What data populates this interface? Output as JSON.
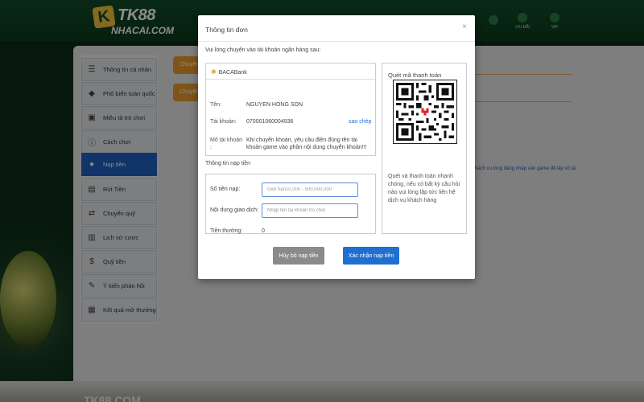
{
  "site": {
    "logo_mark": "K",
    "logo_brand": "TK88",
    "logo_site": "NHACAI.COM",
    "nav_labels": [
      "",
      "",
      "",
      "",
      "",
      "",
      "",
      "",
      "",
      "",
      "",
      "",
      "ƯU ĐÃI",
      "VIP"
    ],
    "footer_logo": "TK88.COM"
  },
  "sidebar": {
    "items": [
      {
        "label": "Thông tin cá nhân",
        "icon": "user-card-icon",
        "active": false
      },
      {
        "label": "Phổ biến toàn quốc",
        "icon": "diamond-icon",
        "active": false
      },
      {
        "label": "Miêu tả trò chơi",
        "icon": "gamepad-icon",
        "active": false
      },
      {
        "label": "Cách chơi",
        "icon": "info-icon",
        "active": false
      },
      {
        "label": "Nạp tiền",
        "icon": "piggy-bank-icon",
        "active": true
      },
      {
        "label": "Rút Tiền",
        "icon": "withdraw-icon",
        "active": false
      },
      {
        "label": "Chuyển quỹ",
        "icon": "transfer-icon",
        "active": false
      },
      {
        "label": "Lịch sử cược",
        "icon": "history-icon",
        "active": false
      },
      {
        "label": "Quỹ tiền",
        "icon": "fund-icon",
        "active": false
      },
      {
        "label": "Ý kiến phản hồi",
        "icon": "feedback-icon",
        "active": false
      },
      {
        "label": "Kết quả mở thưởng",
        "icon": "results-icon",
        "active": false
      }
    ]
  },
  "main": {
    "tabs": [
      "Chuyển",
      "Chuyển"
    ],
    "note": "hách vụ lòng đăng nhập vào game để lấy số tài"
  },
  "modal": {
    "title": "Thông tin đơn",
    "close": "×",
    "instruction": "Vui lòng chuyển vào tài khoản ngân hàng sau:",
    "bank": {
      "name": "BACABank",
      "name_label": "Tên:",
      "name_value": "NGUYEN HONG SON",
      "account_label": "Tài khoản:",
      "account_value": "070001060004936",
      "copy_label": "sao chép",
      "memo_label": "Mô tài khoản :",
      "memo_value": "Khi chuyển khoản, yêu cầu điền đúng tên tài khoản game vào phần nội dung chuyển khoản!!!"
    },
    "deposit": {
      "section_title": "Thông tin nạp tiền",
      "amount_label": "Số tiền nạp:",
      "amount_placeholder": "Giới hạn10,000 - 500,000,000",
      "content_label": "Nội dung giao dịch:",
      "content_placeholder": "Nhập tên tài khoản trò chơi",
      "bonus_label": "Tiền thưởng:",
      "bonus_value": "0"
    },
    "qr": {
      "title": "Quét mã thanh toán",
      "note": "Quét và thanh toán nhanh chóng, nếu có bất kỳ câu hỏi nào vui lòng lập tức liên hệ dịch vụ khách hàng"
    },
    "buttons": {
      "cancel": "Hủy bỏ nạp tiền",
      "confirm": "Xác nhận nạp tiền"
    }
  },
  "colors": {
    "active_sidebar": "#1f5fbf",
    "confirm_button": "#1f6fd1",
    "cancel_button": "#8a8a8a",
    "accent_orange": "#e89a2c"
  }
}
